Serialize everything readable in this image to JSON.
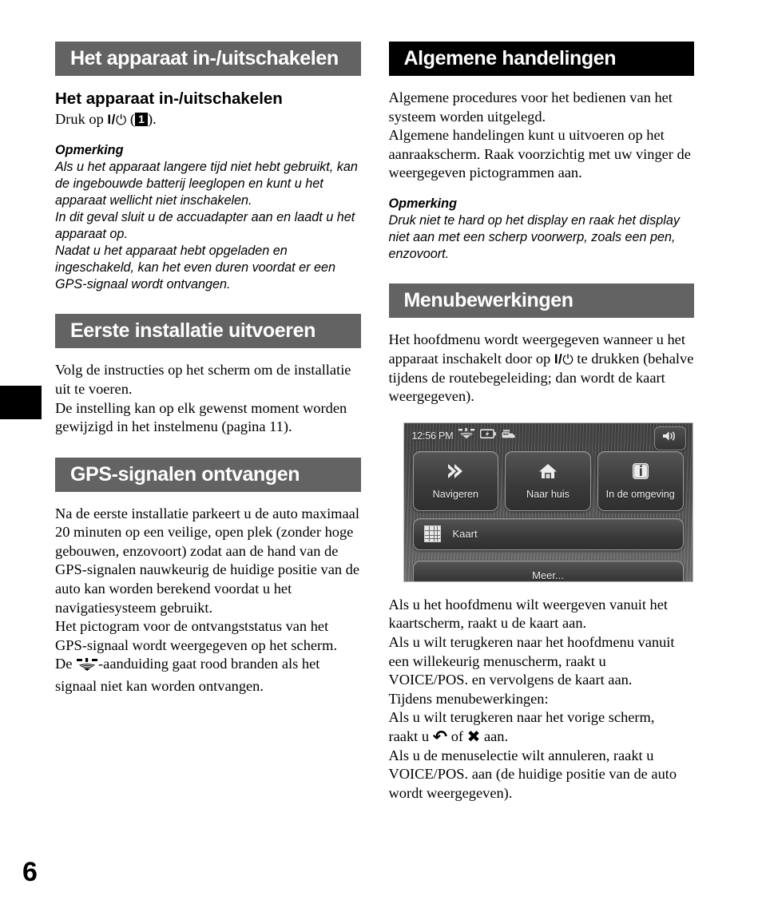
{
  "page": {
    "number": "6",
    "thumb_tab": "black-index-tab"
  },
  "left_column": {
    "section1": {
      "banner": "Het apparaat in-/uitschakelen",
      "banner_style": "gray",
      "subheading": "Het apparaat in-/uitschakelen",
      "instruction_prefix": "Druk op ",
      "power_symbol_label": "I/",
      "power_glyph": "⏻",
      "instruction_open": " (",
      "badge_number": "1",
      "instruction_close": ").",
      "note_title": "Opmerking",
      "note_body": "Als u het apparaat langere tijd niet hebt gebruikt, kan de ingebouwde batterij leeglopen en kunt u het apparaat wellicht niet inschakelen.\nIn dit geval sluit u de accuadapter aan en laadt u het apparaat op.\nNadat u het apparaat hebt opgeladen en ingeschakeld, kan het even duren voordat er een GPS-signaal wordt ontvangen."
    },
    "section2": {
      "banner": "Eerste installatie uitvoeren",
      "banner_style": "gray",
      "paragraph": "Volg de instructies op het scherm om de installatie uit te voeren.\nDe instelling kan op elk gewenst moment worden gewijzigd in het instelmenu (pagina 11)."
    },
    "section3": {
      "banner": "GPS-signalen ontvangen",
      "banner_style": "gray",
      "paragraph1": "Na de eerste installatie parkeert u de auto maximaal 20 minuten op een veilige, open plek (zonder hoge gebouwen, enzovoort) zodat aan de hand van de GPS-signalen nauwkeurig de huidige positie van de auto kan worden berekend voordat u het navigatiesysteem gebruikt.",
      "paragraph2_part1": "Het pictogram voor de ontvangststatus van het GPS-signaal wordt weergegeven op het scherm.\nDe ",
      "gps_icon_name": "gps-reception-icon",
      "paragraph2_part2": "-aanduiding gaat rood branden als het signaal niet kan worden ontvangen."
    }
  },
  "right_column": {
    "section1": {
      "banner": "Algemene handelingen",
      "banner_style": "black",
      "paragraph": "Algemene procedures voor het bedienen van het systeem worden uitgelegd.\nAlgemene handelingen kunt u uitvoeren op het aanraakscherm. Raak voorzichtig met uw vinger de weergegeven pictogrammen aan.",
      "note_title": "Opmerking",
      "note_body": "Druk niet te hard op het display en raak het display niet aan met een scherp voorwerp, zoals een pen, enzovoort."
    },
    "section2": {
      "banner": "Menubewerkingen",
      "banner_style": "gray",
      "intro_part1": "Het hoofdmenu wordt weergegeven wanneer u het apparaat inschakelt door op ",
      "power_symbol_label": "I/",
      "power_glyph": "⏻",
      "intro_part2": " te drukken (behalve tijdens de routebegeleiding; dan wordt de kaart weergegeven).",
      "after_image_paragraph": "Als u het hoofdmenu wilt weergeven vanuit het kaartscherm, raakt u de kaart aan.\nAls u wilt terugkeren naar het hoofdmenu vanuit een willekeurig menuscherm, raakt u\nVOICE/POS. en vervolgens de kaart aan.",
      "menu_ops_heading": "Tijdens menubewerkingen:",
      "back_line_part1": "Als u wilt terugkeren naar het vorige scherm,\nraakt u ",
      "back_icon_name": "back-arrow-icon",
      "back_line_mid": " of ",
      "close_icon_name": "close-x-icon",
      "back_line_part2": " aan.",
      "cancel_paragraph": "Als u de menuselectie wilt annuleren, raakt u VOICE/POS. aan (de huidige positie van de auto wordt weergegeven)."
    },
    "device_screenshot": {
      "name": "main-menu-screenshot",
      "clock": "12:56 PM",
      "status_icons": [
        "gps-status-icon",
        "battery-charging-icon",
        "traffic-status-icon"
      ],
      "speaker_icon": "speaker-volume-icon",
      "tiles": [
        {
          "label": "Navigeren",
          "icon": "double-chevron-right-icon"
        },
        {
          "label": "Naar huis",
          "icon": "home-icon"
        },
        {
          "label": "In de omgeving",
          "icon": "info-icon"
        }
      ],
      "map_button": {
        "label": "Kaart",
        "icon": "grid-map-icon"
      },
      "more_button": {
        "label": "Meer..."
      }
    }
  },
  "colors": {
    "banner_gray": "#636363",
    "banner_black": "#000000",
    "text": "#000000",
    "page_bg": "#ffffff"
  }
}
